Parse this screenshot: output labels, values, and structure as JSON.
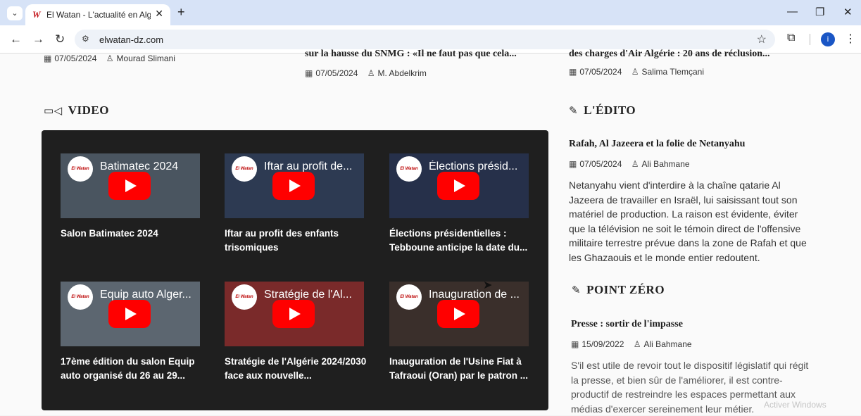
{
  "browser": {
    "tab_title": "El Watan - L'actualité en Algérie",
    "favicon": "W",
    "url": "elwatan-dz.com",
    "profile_initial": "i"
  },
  "top_articles": [
    {
      "title": "",
      "date": "07/05/2024",
      "author": "Mourad Slimani"
    },
    {
      "title": "sur la hausse du SNMG : «Il ne faut pas que cela...",
      "date": "07/05/2024",
      "author": "M. Abdelkrim"
    },
    {
      "title": "des charges d'Air Algérie : 20 ans de réclusion...",
      "date": "07/05/2024",
      "author": "Salima Tlemçani"
    }
  ],
  "video_section": {
    "heading": "VIDEO",
    "logo_text": "El Watan",
    "videos": [
      {
        "thumb_title": "Batimatec 2024",
        "caption": "Salon Batimatec 2024"
      },
      {
        "thumb_title": "Iftar au profit de...",
        "caption": "Iftar au profit des enfants trisomiques"
      },
      {
        "thumb_title": "Élections présid...",
        "caption": "Élections présidentielles : Tebboune anticipe la date du..."
      },
      {
        "thumb_title": "Equip auto Alger...",
        "caption": "17ème édition du salon Equip auto organisé du 26 au 29..."
      },
      {
        "thumb_title": "Stratégie de l'Al...",
        "caption": "Stratégie de l'Algérie 2024/2030 face aux nouvelle..."
      },
      {
        "thumb_title": "Inauguration de ...",
        "caption": "Inauguration de l'Usine Fiat à Tafraoui (Oran) par le patron ..."
      }
    ]
  },
  "edito": {
    "heading": "L'ÉDITO",
    "title": "Rafah, Al Jazeera et la folie de Netanyahu",
    "date": "07/05/2024",
    "author": "Ali Bahmane",
    "excerpt": "Netanyahu vient d'interdire à la chaîne qatarie Al Jazeera de travailler en Israël, lui saisissant tout son matériel de production. La raison est évidente, éviter que la télévision ne soit le témoin direct de l'offensive militaire terrestre prévue dans la zone de Rafah et que les Ghazaouis et le monde entier redoutent."
  },
  "point_zero": {
    "heading": "POINT ZÉRO",
    "title": "Presse : sortir de l'impasse",
    "date": "15/09/2022",
    "author": "Ali Bahmane",
    "excerpt": "S'il est utile de revoir tout le dispositif législatif qui régit la presse, et bien sûr de l'améliorer, il est contre-productif de restreindre les espaces permettant aux médias d'exercer sereinement leur métier."
  },
  "watermark": "Activer Windows",
  "colors": {
    "play_button": "#ff0000",
    "video_bg": "#1f1f1f",
    "tabbar": "#d7e3f7",
    "profile": "#1a56c5"
  }
}
